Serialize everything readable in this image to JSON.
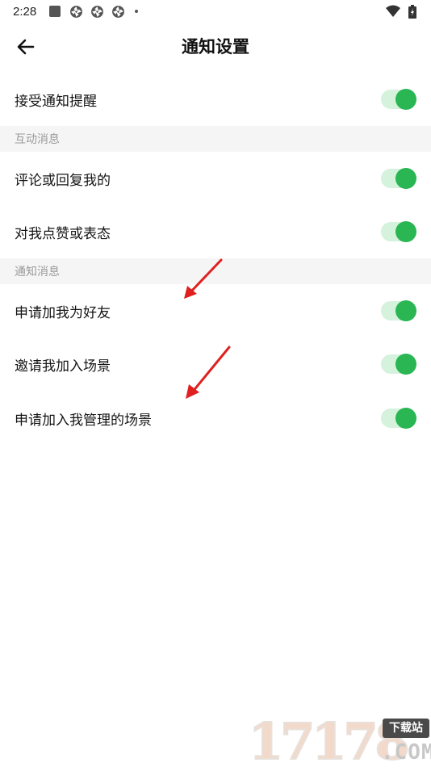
{
  "status_bar": {
    "time": "2:28",
    "icons": [
      "stop-square-icon",
      "aperture-icon",
      "aperture-icon",
      "aperture-icon"
    ],
    "right_icons": [
      "wifi-icon",
      "battery-icon"
    ]
  },
  "app_bar": {
    "back_icon": "arrow-left-icon",
    "title": "通知设置"
  },
  "master": {
    "label": "接受通知提醒",
    "enabled": true
  },
  "sections": [
    {
      "header": "互动消息",
      "items": [
        {
          "label": "评论或回复我的",
          "enabled": true
        },
        {
          "label": "对我点赞或表态",
          "enabled": true
        }
      ]
    },
    {
      "header": "通知消息",
      "items": [
        {
          "label": "申请加我为好友",
          "enabled": true
        },
        {
          "label": "邀请我加入场景",
          "enabled": true
        },
        {
          "label": "申请加入我管理的场景",
          "enabled": true
        }
      ]
    }
  ],
  "watermark": {
    "digits": "17178",
    "badge": "下载站",
    "suffix": ".COM"
  },
  "colors": {
    "toggle_knob": "#29b653",
    "toggle_track": "#d5f2dd",
    "section_bg": "#f5f5f5",
    "section_text": "#9a9a9a",
    "annotation_arrow": "#e02020"
  }
}
